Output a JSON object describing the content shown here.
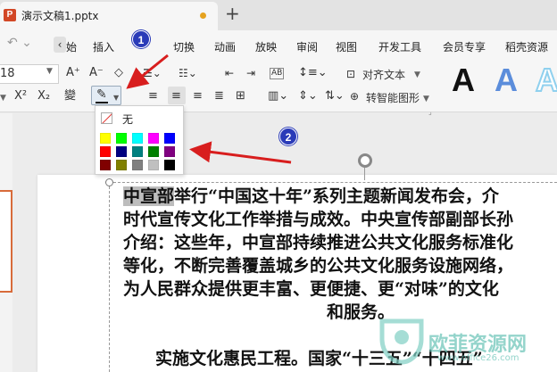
{
  "tab": {
    "app_icon": "P",
    "title": "演示文稿1.pptx",
    "new_tab": "+"
  },
  "menu": {
    "items": [
      "始",
      "插入",
      "切换",
      "动画",
      "放映",
      "审阅",
      "视图",
      "开发工具",
      "会员专享",
      "稻壳资源"
    ],
    "nav_arrow": "‹"
  },
  "toolbar": {
    "font_size": "18",
    "align_text": "对齐文本",
    "smart_graphic": "转智能图形",
    "superscript": "X²",
    "subscript": "X₂",
    "phonetic": "變",
    "grow_font": "A⁺",
    "shrink_font": "A⁻",
    "ab_label": "AB"
  },
  "styles": {
    "letter": "A",
    "colors": [
      "#111111",
      "#5b8ddb",
      "#8fd0ee"
    ]
  },
  "highlight_dropdown": {
    "no_color_label": "无",
    "swatches": [
      [
        "#ffff00",
        "#00ff00",
        "#00ffff",
        "#ff00ff",
        "#0000ff"
      ],
      [
        "#ff0000",
        "#000080",
        "#008080",
        "#008000",
        "#800080"
      ],
      [
        "#800000",
        "#808000",
        "#808080",
        "#c0c0c0",
        "#000000"
      ]
    ]
  },
  "annotations": {
    "badge1": "1",
    "badge2": "2",
    "arrow_color": "#d81e1e",
    "badge_color": "#2a3bb8"
  },
  "slide": {
    "highlighted": "中宣部",
    "line1_rest": "举行“中国这十年”系列主题新闻发布会，介",
    "line2": "时代宣传文化工作举措与成效。中央宣传部副部长孙",
    "line3": "介绍：这些年，中宣部持续推进公共文化服务标准化",
    "line4": "等化，不断完善覆盖城乡的公共文化服务设施网络，",
    "line5": "为人民群众提供更丰富、更便捷、更“对味”的文化",
    "line6": "和服务。",
    "line7": "实施文化惠民工程。国家“十三五”“十四五”"
  },
  "watermark": {
    "text": "欧菲资源网",
    "url": "www.office26.com"
  }
}
